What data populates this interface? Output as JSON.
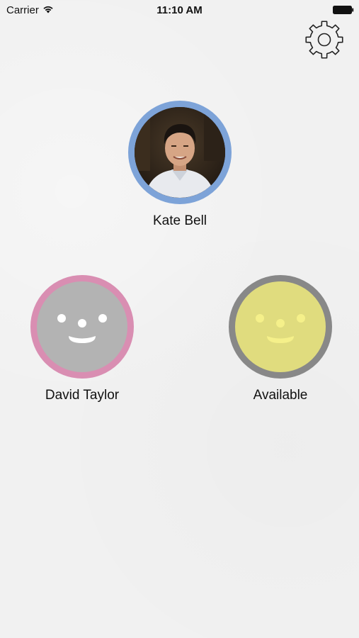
{
  "status_bar": {
    "carrier": "Carrier",
    "time": "11:10 AM",
    "wifi_icon": "wifi-icon",
    "battery_icon": "battery-icon"
  },
  "settings": {
    "icon": "gear-icon"
  },
  "persons": [
    {
      "name": "Kate Bell",
      "ring_color": "#7da3d8",
      "avatar": "photo"
    },
    {
      "name": "David Taylor",
      "ring_color": "#d98eb2",
      "avatar": "smiley",
      "face_color": "#b3b3b3"
    },
    {
      "name": "Available",
      "ring_color": "#888888",
      "avatar": "smiley",
      "face_color": "#e0dc7e"
    }
  ]
}
